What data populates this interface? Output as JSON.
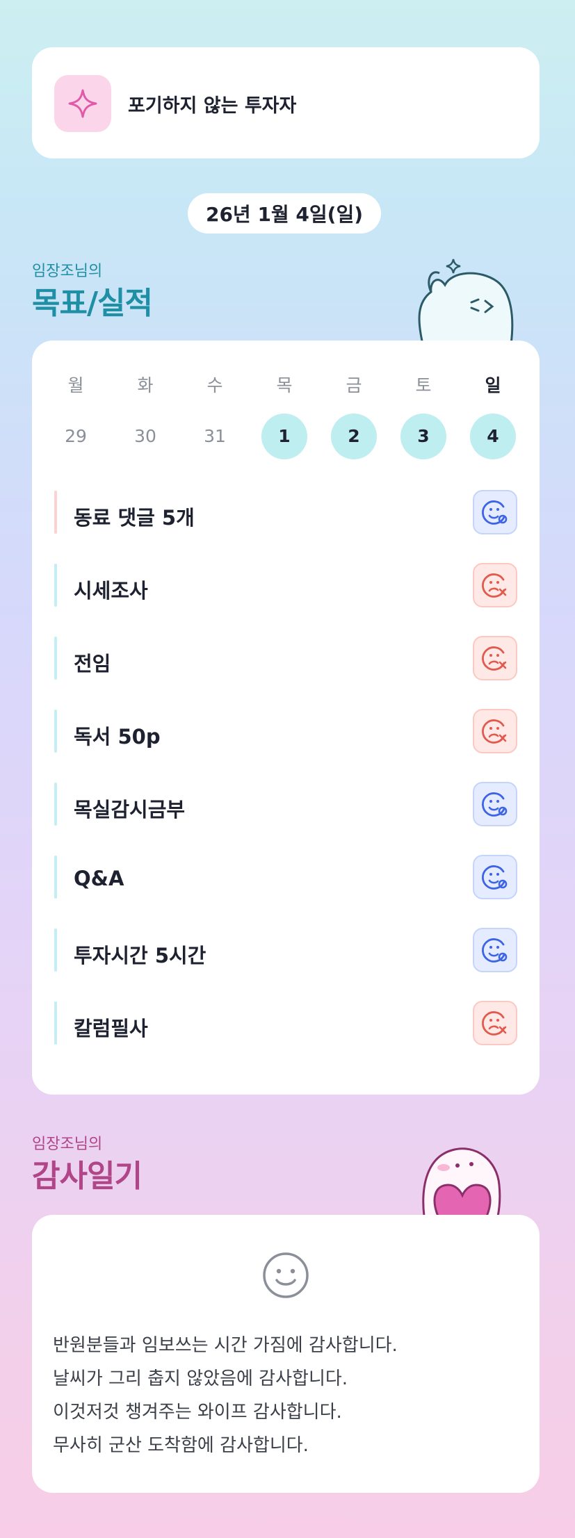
{
  "header": {
    "title": "포기하지 않는 투자자",
    "icon": "sparkle-icon"
  },
  "date": "26년 1월 4일(일)",
  "goals_section": {
    "owner": "임장조님의",
    "title": "목표/실적"
  },
  "calendar": {
    "weekdays": [
      "월",
      "화",
      "수",
      "목",
      "금",
      "토",
      "일"
    ],
    "days": [
      "29",
      "30",
      "31",
      "1",
      "2",
      "3",
      "4"
    ],
    "active_days": [
      "1",
      "2",
      "3",
      "4"
    ]
  },
  "goals": [
    {
      "label": "동료 댓글 5개",
      "status": "done"
    },
    {
      "label": "시세조사",
      "status": "missed"
    },
    {
      "label": "전임",
      "status": "missed"
    },
    {
      "label": "독서 50p",
      "status": "missed"
    },
    {
      "label": "목실감시금부",
      "status": "done"
    },
    {
      "label": "Q&A",
      "status": "done"
    },
    {
      "label": "투자시간 5시간",
      "status": "done"
    },
    {
      "label": "칼럼필사",
      "status": "missed"
    }
  ],
  "thanks_section": {
    "owner": "임장조님의",
    "title": "감사일기",
    "icon": "smile-face-icon"
  },
  "diary_lines": [
    "반원분들과 임보쓰는 시간 가짐에 감사합니다.",
    "날씨가 그리 춥지 않았음에 감사합니다.",
    "이것저것 챙겨주는 와이프 감사합니다.",
    "무사히 군산 도착함에 감사합니다."
  ],
  "colors": {
    "accent_teal": "#1e8fa5",
    "accent_pink": "#b04587",
    "done_blue": "#3d63e6",
    "missed_red": "#e25a4e",
    "active_day_bg": "#bfeef1"
  }
}
